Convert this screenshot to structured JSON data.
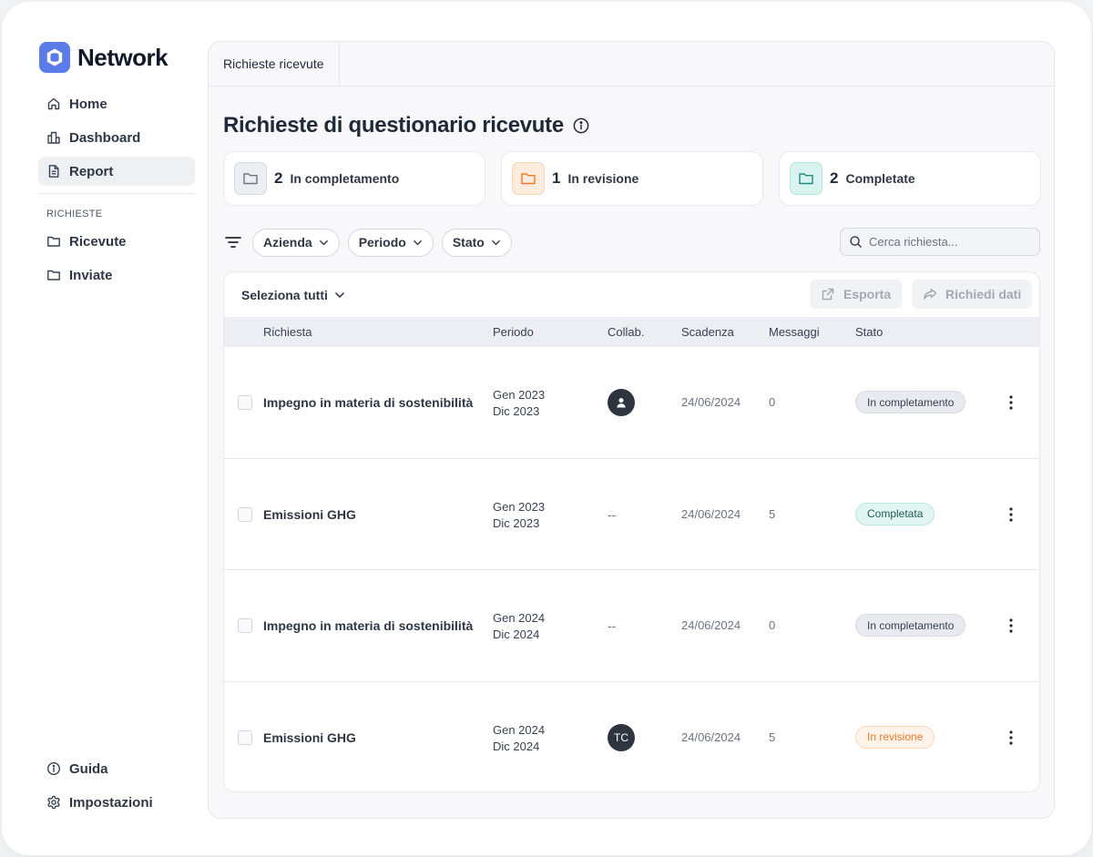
{
  "app": {
    "name": "Network",
    "brand_color": "#5b7be8"
  },
  "sidebar": {
    "items": [
      {
        "label": "Home",
        "icon": "home-icon"
      },
      {
        "label": "Dashboard",
        "icon": "chart-bars-icon"
      },
      {
        "label": "Report",
        "icon": "document-icon",
        "active": true
      }
    ],
    "section_label": "RICHIESTE",
    "section_items": [
      {
        "label": "Ricevute",
        "icon": "folder-icon"
      },
      {
        "label": "Inviate",
        "icon": "folder-icon"
      }
    ],
    "bottom_items": [
      {
        "label": "Guida",
        "icon": "info-circle-icon"
      },
      {
        "label": "Impostazioni",
        "icon": "gear-icon"
      }
    ]
  },
  "tabs": [
    {
      "label": "Richieste ricevute",
      "active": true
    }
  ],
  "page": {
    "title": "Richieste di questionario ricevute"
  },
  "stats": [
    {
      "count": "2",
      "label": "In completamento",
      "icon": "folder-icon",
      "color": "#6b7280",
      "bg": "#eceef3"
    },
    {
      "count": "1",
      "label": "In revisione",
      "icon": "folder-icon",
      "color": "#ea7a26",
      "bg": "#fdebdd"
    },
    {
      "count": "2",
      "label": "Completate",
      "icon": "folder-icon",
      "color": "#1f8a7a",
      "bg": "#d9f4f0"
    }
  ],
  "filters": {
    "chips": [
      "Azienda",
      "Periodo",
      "Stato"
    ],
    "search_placeholder": "Cerca richiesta..."
  },
  "table": {
    "select_all": "Seleziona tutti",
    "actions": {
      "export": "Esporta",
      "request_data": "Richiedi dati"
    },
    "columns": {
      "request": "Richiesta",
      "period": "Periodo",
      "collab": "Collab.",
      "due": "Scadenza",
      "messages": "Messaggi",
      "status": "Stato"
    },
    "rows": [
      {
        "title": "Impegno in materia di sostenibilità",
        "period_start": "Gen 2023",
        "period_end": "Dic 2023",
        "collab": "avatar-user-icon",
        "due": "24/06/2024",
        "messages": "0",
        "status": "In completamento",
        "status_key": "completamento"
      },
      {
        "title": "Emissioni GHG",
        "period_start": "Gen 2023",
        "period_end": "Dic 2023",
        "collab": "--",
        "due": "24/06/2024",
        "messages": "5",
        "status": "Completata",
        "status_key": "completata"
      },
      {
        "title": "Impegno in materia di sostenibilità",
        "period_start": "Gen 2024",
        "period_end": "Dic 2024",
        "collab": "--",
        "due": "24/06/2024",
        "messages": "0",
        "status": "In completamento",
        "status_key": "completamento"
      },
      {
        "title": "Emissioni GHG",
        "period_start": "Gen 2024",
        "period_end": "Dic 2024",
        "collab": "TC",
        "due": "24/06/2024",
        "messages": "5",
        "status": "In revisione",
        "status_key": "revisione"
      }
    ]
  }
}
